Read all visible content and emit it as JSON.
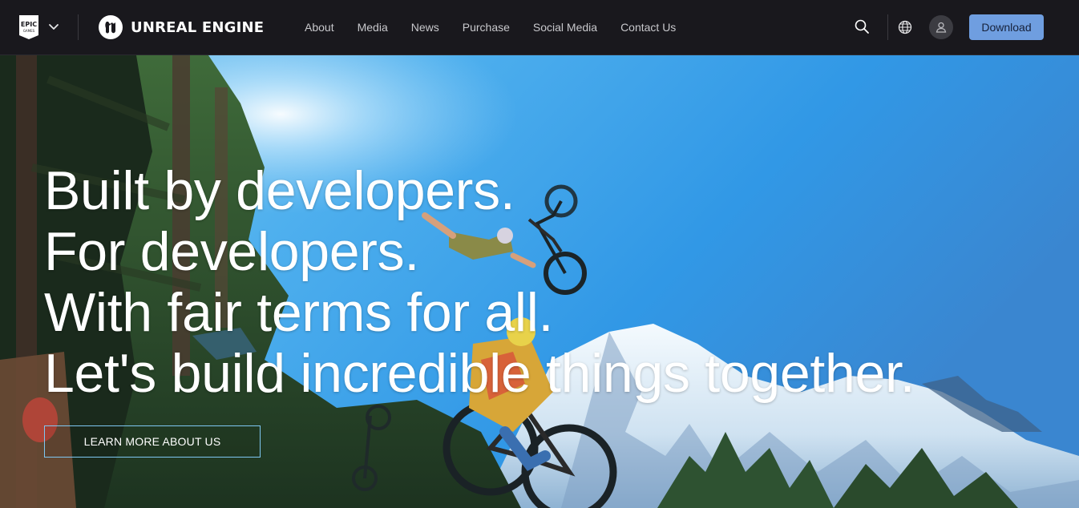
{
  "header": {
    "epic_logo_text": "EPIC GAMES",
    "brand_name": "UNREAL ENGINE",
    "nav": [
      {
        "label": "About"
      },
      {
        "label": "Media"
      },
      {
        "label": "News"
      },
      {
        "label": "Purchase"
      },
      {
        "label": "Social Media"
      },
      {
        "label": "Contact Us"
      }
    ],
    "download_label": "Download",
    "icons": {
      "search": "search-icon",
      "language": "globe-icon",
      "account": "user-icon",
      "epic_menu": "chevron-down-icon"
    },
    "colors": {
      "bar_background": "#19181d",
      "download_button": "#6f9ee0",
      "nav_text": "#c8c8cc"
    }
  },
  "hero": {
    "headline": [
      "Built by developers.",
      "For developers.",
      "With fair terms for all.",
      "Let's build incredible things together."
    ],
    "cta_label": "LEARN MORE ABOUT US",
    "colors": {
      "cta_border": "#7ec7f2",
      "sky": "#3e9fe6"
    }
  }
}
